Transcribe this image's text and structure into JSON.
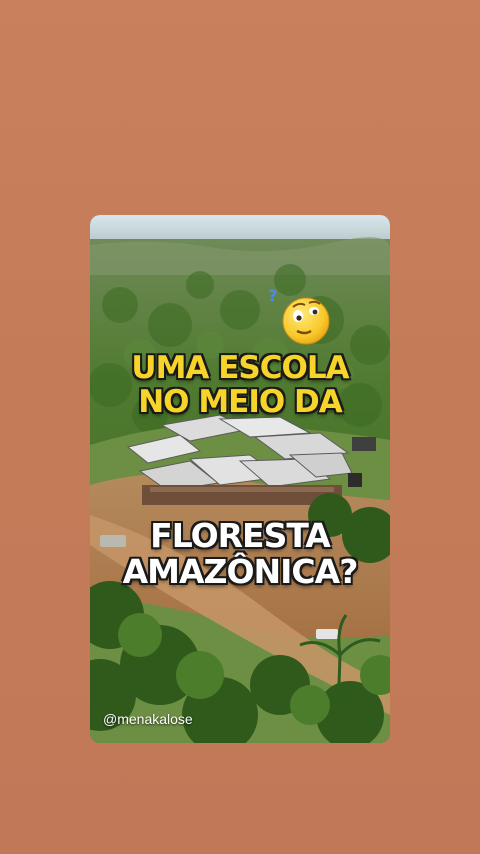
{
  "story": {
    "headline": {
      "line1": "UMA ESCOLA",
      "line2": "NO MEIO DA",
      "line3": "FLORESTA",
      "line4": "AMAZÔNICA?"
    },
    "emoji": "thinking-face-with-question-mark-icon",
    "handle": "@menakalose"
  },
  "colors": {
    "background": "#c47c58",
    "headline_yellow": "#f7d42a",
    "headline_white": "#ffffff",
    "outline": "#1a1a1a"
  }
}
